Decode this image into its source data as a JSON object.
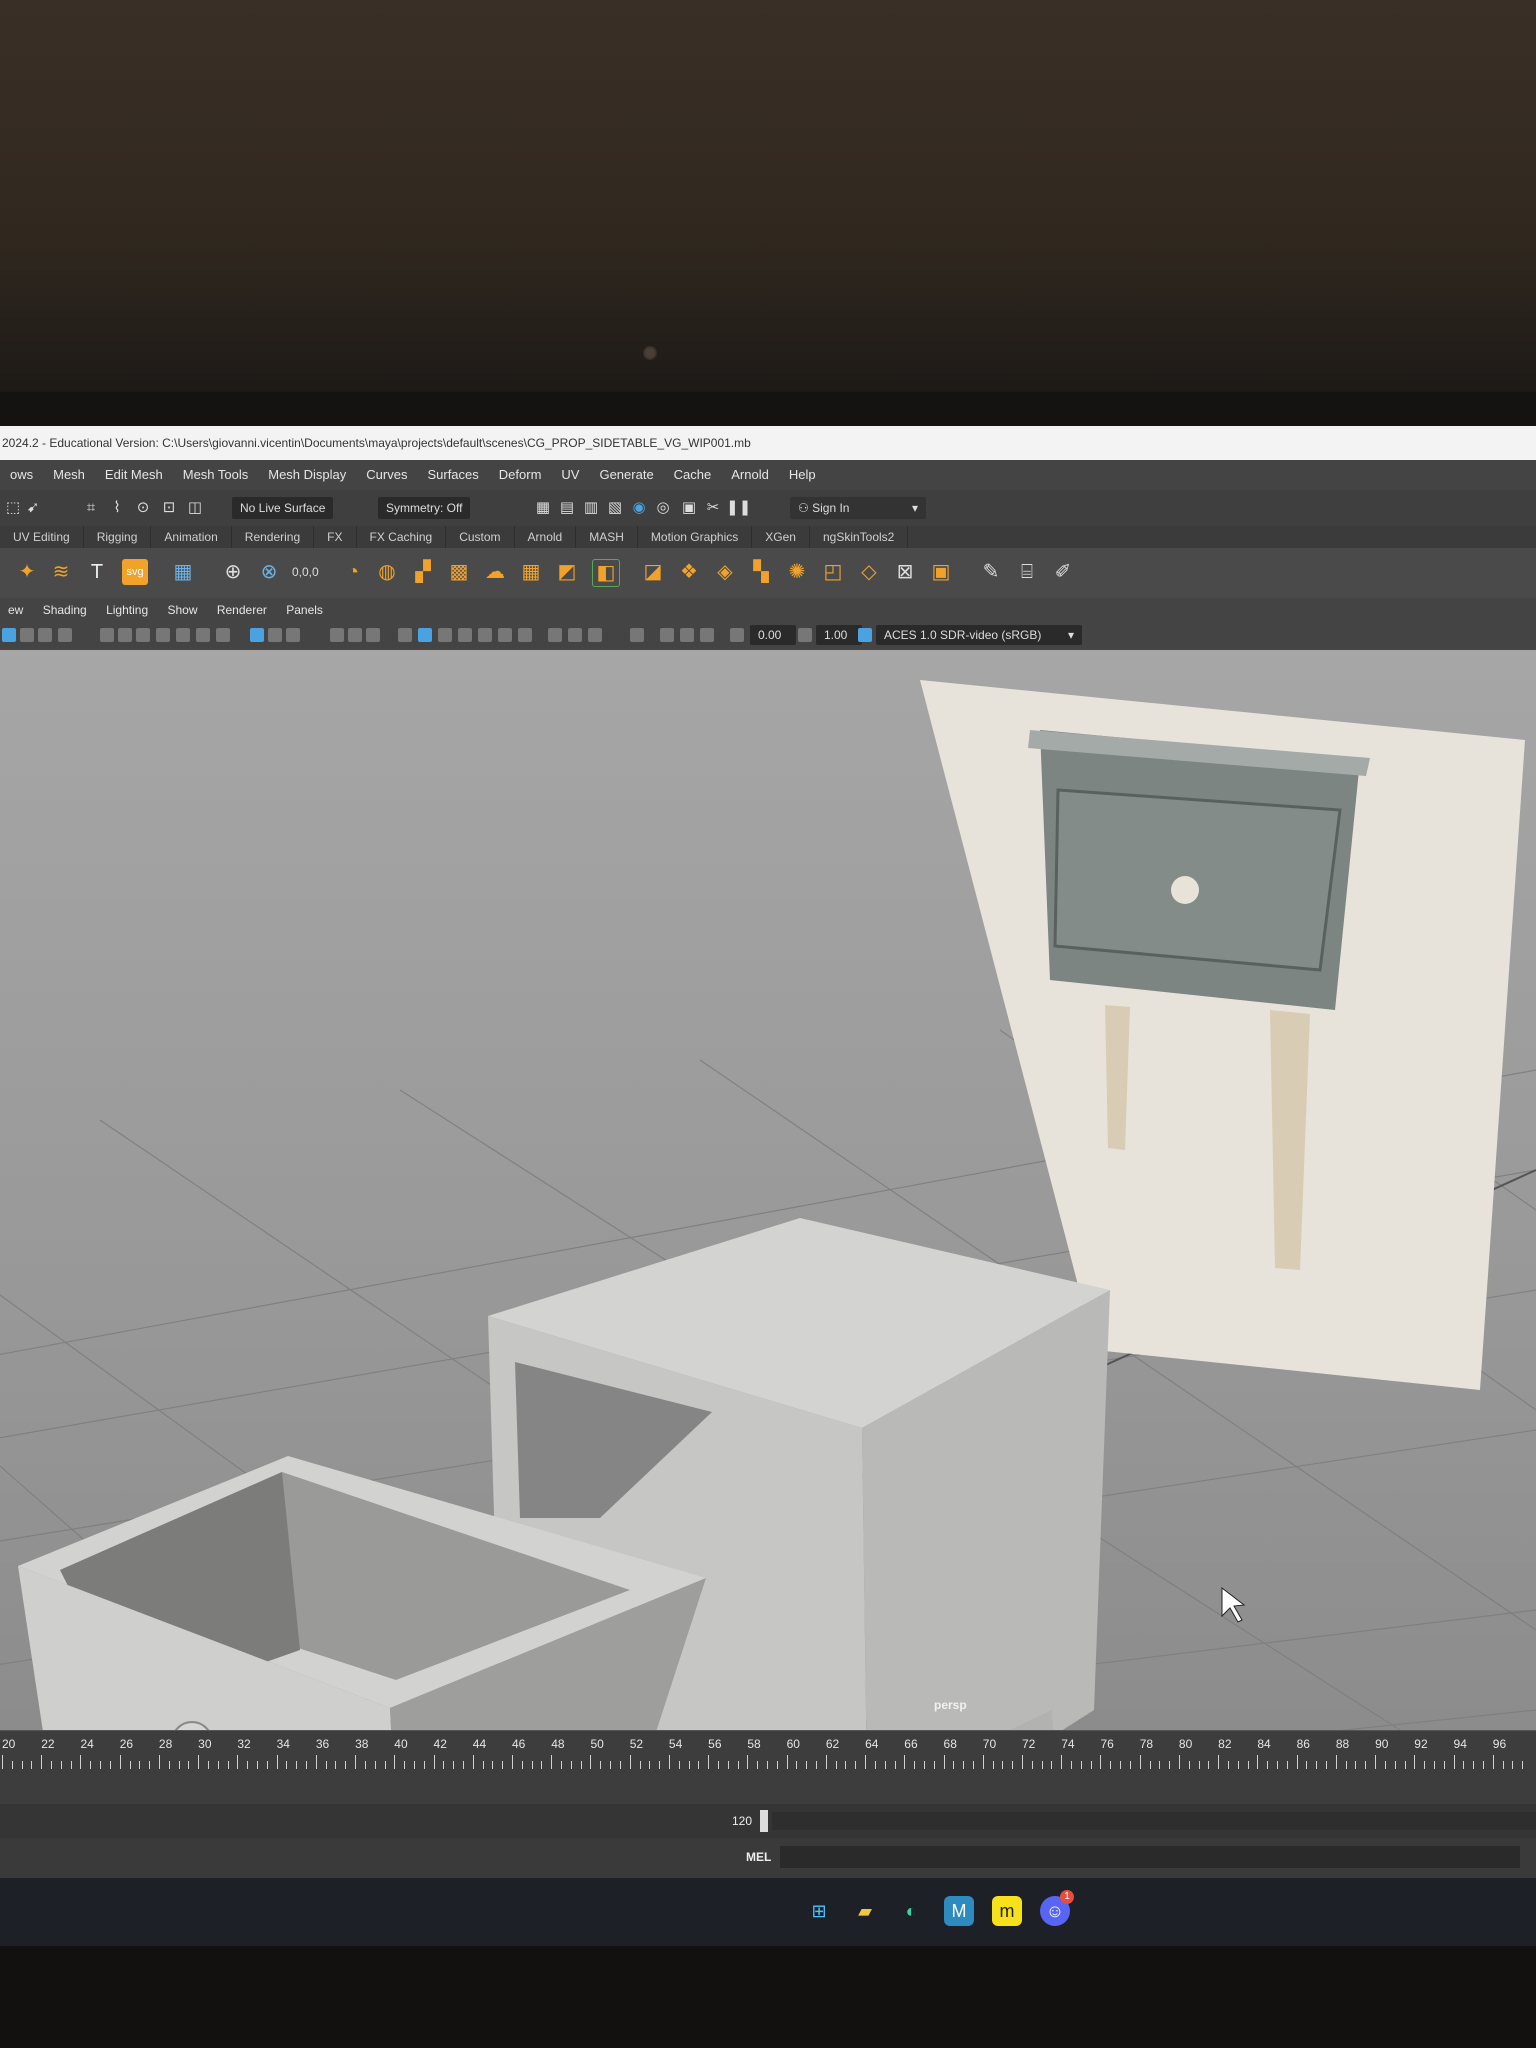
{
  "window": {
    "title": "2024.2 - Educational Version: C:\\Users\\giovanni.vicentin\\Documents\\maya\\projects\\default\\scenes\\CG_PROP_SIDETABLE_VG_WIP001.mb"
  },
  "menubar": {
    "items": [
      "ows",
      "Mesh",
      "Edit Mesh",
      "Mesh Tools",
      "Mesh Display",
      "Curves",
      "Surfaces",
      "Deform",
      "UV",
      "Generate",
      "Cache",
      "Arnold",
      "Help"
    ]
  },
  "statusline": {
    "live_surface": "No Live Surface",
    "symmetry": "Symmetry: Off",
    "sign_in": "Sign In"
  },
  "shelf_tabs": [
    "UV Editing",
    "Rigging",
    "Animation",
    "Rendering",
    "FX",
    "FX Caching",
    "Custom",
    "Arnold",
    "MASH",
    "Motion Graphics",
    "XGen",
    "ngSkinTools2"
  ],
  "panel_menu": [
    "ew",
    "Shading",
    "Lighting",
    "Show",
    "Renderer",
    "Panels"
  ],
  "panel_toolbar": {
    "exposure": "0.00",
    "gamma": "1.00",
    "color_space": "ACES 1.0 SDR-video (sRGB)"
  },
  "viewport": {
    "camera_label": "persp"
  },
  "timeline": {
    "ticks": [
      "20",
      "22",
      "24",
      "26",
      "28",
      "30",
      "32",
      "34",
      "36",
      "38",
      "40",
      "42",
      "44",
      "46",
      "48",
      "50",
      "52",
      "54",
      "56",
      "58",
      "60",
      "62",
      "64",
      "66",
      "68",
      "70",
      "72",
      "74",
      "76",
      "78",
      "80",
      "82",
      "84",
      "86",
      "88",
      "90",
      "92",
      "94",
      "96"
    ],
    "end_frame": "120"
  },
  "cmdline": {
    "label": "MEL"
  },
  "colors": {
    "maya_orange": "#f0a22a",
    "ui_dark": "#444444",
    "viewport_bg": "#9c9c9c"
  },
  "taskbar_icons": [
    "windows-start-icon",
    "file-explorer-icon",
    "edge-icon",
    "maya-icon",
    "miro-icon",
    "discord-icon"
  ],
  "taskbar_badge": "1"
}
